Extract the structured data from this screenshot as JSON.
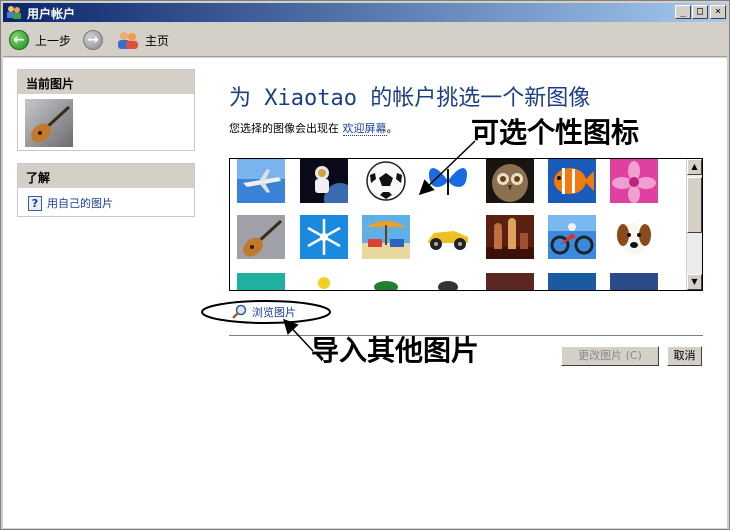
{
  "window": {
    "title": "用户帐户",
    "controls": {
      "minimize": "_",
      "maximize": "□",
      "close": "×"
    }
  },
  "toolbar": {
    "back_label": "上一步",
    "home_label": "主页"
  },
  "left": {
    "current_picture_heading": "当前图片",
    "learn_heading": "了解",
    "learn_link": "用自己的图片"
  },
  "main": {
    "title": "为 Xiaotao 的帐户挑选一个新图像",
    "subtitle_prefix": "您选择的图像会出现在",
    "subtitle_link": "欢迎屏幕",
    "subtitle_suffix": "。",
    "browse_label": "浏览图片",
    "change_button": "更改图片 (C)",
    "cancel_button": "取消"
  },
  "pictures": [
    {
      "name": "airplane-picture"
    },
    {
      "name": "astronaut-picture"
    },
    {
      "name": "soccer-ball-picture"
    },
    {
      "name": "butterfly-picture"
    },
    {
      "name": "owl-picture"
    },
    {
      "name": "fish-picture"
    },
    {
      "name": "flower-picture"
    },
    {
      "name": "guitar-picture"
    },
    {
      "name": "snowflake-picture"
    },
    {
      "name": "beach-chairs-picture"
    },
    {
      "name": "race-car-picture"
    },
    {
      "name": "chess-picture"
    },
    {
      "name": "dirt-bike-picture"
    },
    {
      "name": "dog-picture"
    }
  ],
  "annotations": {
    "choose_icon": "可选个性图标",
    "import_other": "导入其他图片"
  },
  "colors": {
    "title_blue": "#1b3f86",
    "link_blue": "#1a3d9a",
    "titlebar_start": "#0a246a",
    "titlebar_end": "#a6caf0"
  }
}
